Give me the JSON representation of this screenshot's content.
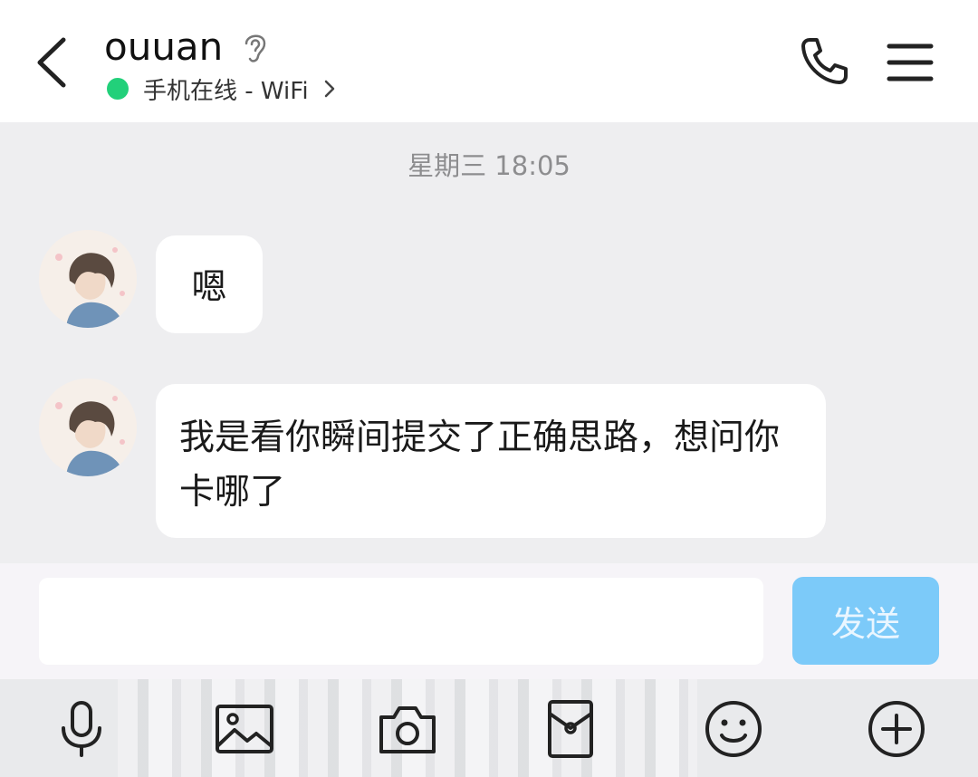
{
  "header": {
    "contact_name": "ouuan",
    "status": "手机在线 - WiFi",
    "icons": {
      "back": "back-chevron-icon",
      "ear": "ear-icon",
      "status_dot": "online-dot-icon",
      "status_chevron": "chevron-right-icon",
      "call": "phone-icon",
      "menu": "menu-icon"
    },
    "status_color": "#22d07a"
  },
  "chat": {
    "timestamp": "星期三 18:05",
    "messages": [
      {
        "sender": "ouuan",
        "text": "嗯"
      },
      {
        "sender": "ouuan",
        "text": "我是看你瞬间提交了正确思路，想问你卡哪了"
      }
    ]
  },
  "composer": {
    "input_value": "",
    "send_label": "发送",
    "send_color": "#7ccaf9"
  },
  "toolbar": {
    "items": [
      "voice-icon",
      "image-icon",
      "camera-icon",
      "red-packet-icon",
      "emoji-icon",
      "plus-icon"
    ]
  }
}
